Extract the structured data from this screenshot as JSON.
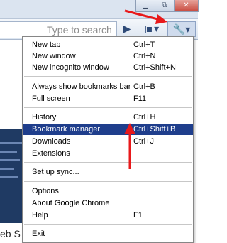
{
  "window": {
    "minimize_glyph": "▁",
    "restore_glyph": "⧉",
    "close_glyph": "✕"
  },
  "toolbar": {
    "search_placeholder": "Type to search",
    "play_icon_glyph": "▶",
    "page_icon_glyph": "▣▾",
    "wrench_icon_glyph": "🔧▾"
  },
  "page": {
    "text_fragment": "eb S"
  },
  "menu": {
    "items": [
      {
        "label": "New tab",
        "shortcut": "Ctrl+T"
      },
      {
        "label": "New window",
        "shortcut": "Ctrl+N"
      },
      {
        "label": "New incognito window",
        "shortcut": "Ctrl+Shift+N"
      },
      {
        "label": "Always show bookmarks bar",
        "shortcut": "Ctrl+B"
      },
      {
        "label": "Full screen",
        "shortcut": "F11"
      },
      {
        "label": "History",
        "shortcut": "Ctrl+H"
      },
      {
        "label": "Bookmark manager",
        "shortcut": "Ctrl+Shift+B",
        "highlighted": true
      },
      {
        "label": "Downloads",
        "shortcut": "Ctrl+J"
      },
      {
        "label": "Extensions",
        "shortcut": ""
      },
      {
        "label": "Set up sync...",
        "shortcut": ""
      },
      {
        "label": "Options",
        "shortcut": ""
      },
      {
        "label": "About Google Chrome",
        "shortcut": ""
      },
      {
        "label": "Help",
        "shortcut": "F1"
      },
      {
        "label": "Exit",
        "shortcut": ""
      }
    ]
  },
  "colors": {
    "highlight": "#1f3e8c",
    "annotation_arrow": "#e8191b"
  }
}
